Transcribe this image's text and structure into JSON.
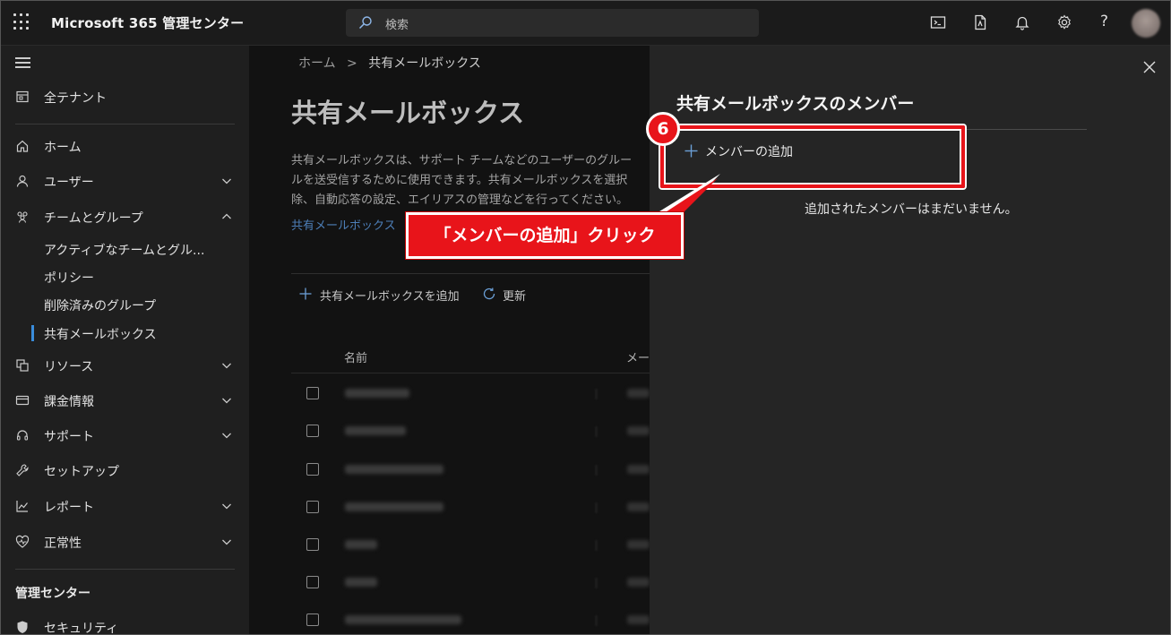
{
  "topbar": {
    "app_title": "Microsoft 365 管理センター",
    "search_placeholder": "検索",
    "icons": [
      "terminal-icon",
      "document-icon",
      "bell-icon",
      "gear-icon",
      "help-icon"
    ],
    "help_glyph": "?"
  },
  "sidebar": {
    "items": [
      {
        "label": "全テナント",
        "icon": "tenant-icon"
      },
      {
        "label": "ホーム",
        "icon": "home-icon"
      },
      {
        "label": "ユーザー",
        "icon": "user-icon"
      },
      {
        "label": "チームとグループ",
        "icon": "group-icon"
      },
      {
        "label": "リソース",
        "icon": "resource-icon"
      },
      {
        "label": "課金情報",
        "icon": "billing-icon"
      },
      {
        "label": "サポート",
        "icon": "headset-icon"
      },
      {
        "label": "セットアップ",
        "icon": "wrench-icon"
      },
      {
        "label": "レポート",
        "icon": "chart-icon"
      },
      {
        "label": "正常性",
        "icon": "heart-icon"
      }
    ],
    "sub_items": [
      "アクティブなチームとグル...",
      "ポリシー",
      "削除済みのグループ",
      "共有メールボックス"
    ],
    "section_title": "管理センター",
    "bottom_item": {
      "label": "セキュリティ",
      "icon": "shield-icon"
    }
  },
  "main": {
    "breadcrumb": {
      "home": "ホーム",
      "separator": ">",
      "current": "共有メールボックス"
    },
    "title": "共有メールボックス",
    "description": [
      "共有メールボックスは、サポート チームなどのユーザーのグルー",
      "ルを送受信するために使用できます。共有メールボックスを選択",
      "除、自動応答の設定、エイリアスの管理などを行ってください。"
    ],
    "link": "共有メールボックス",
    "toolbar": {
      "add": "共有メールボックスを追加",
      "refresh": "更新"
    },
    "columns": {
      "name": "名前",
      "email": "メー"
    },
    "row_count": 7
  },
  "panel": {
    "title": "共有メールボックスのメンバー",
    "add_member": "メンバーの追加",
    "empty_message": "追加されたメンバーはまだいません。"
  },
  "annotation": {
    "step": "6",
    "label": "「メンバーの追加」クリック",
    "color": "#e8141a"
  }
}
